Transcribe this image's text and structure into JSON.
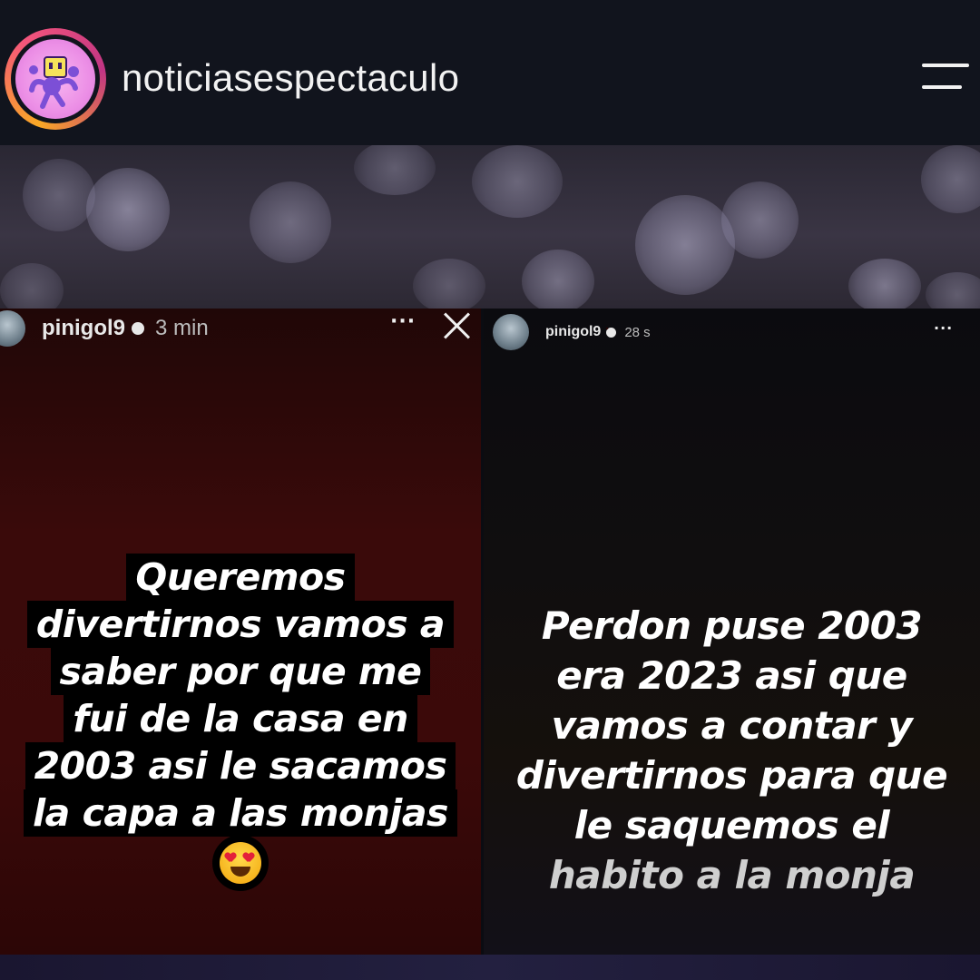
{
  "header": {
    "account_name": "noticiasespectaculo",
    "avatar_icon": "cartoon-mascot-avatar-icon",
    "menu_icon": "hamburger-menu-icon",
    "ring_colors": [
      "#f9a825",
      "#f5567b",
      "#c13584"
    ]
  },
  "stories": [
    {
      "username": "pinigol9",
      "time": "3 min",
      "verified": true,
      "more_label": "···",
      "close_icon": "close-icon",
      "background": "#3b0909",
      "lines": [
        "Queremos",
        "divertirnos vamos a",
        "saber por que me",
        "fui de la casa en",
        "2003 asi le sacamos",
        "la capa a las monjas"
      ],
      "emoji": "heart-eyes-emoji-icon"
    },
    {
      "username": "pinigol9",
      "time": "28 s",
      "verified": true,
      "more_label": "···",
      "background": "#0b0b0f",
      "lines": [
        "Perdon puse 2003",
        "era 2023 asi que",
        "vamos a contar y",
        "divertirnos para que",
        "le saquemos el",
        "habito a la monja"
      ]
    }
  ]
}
